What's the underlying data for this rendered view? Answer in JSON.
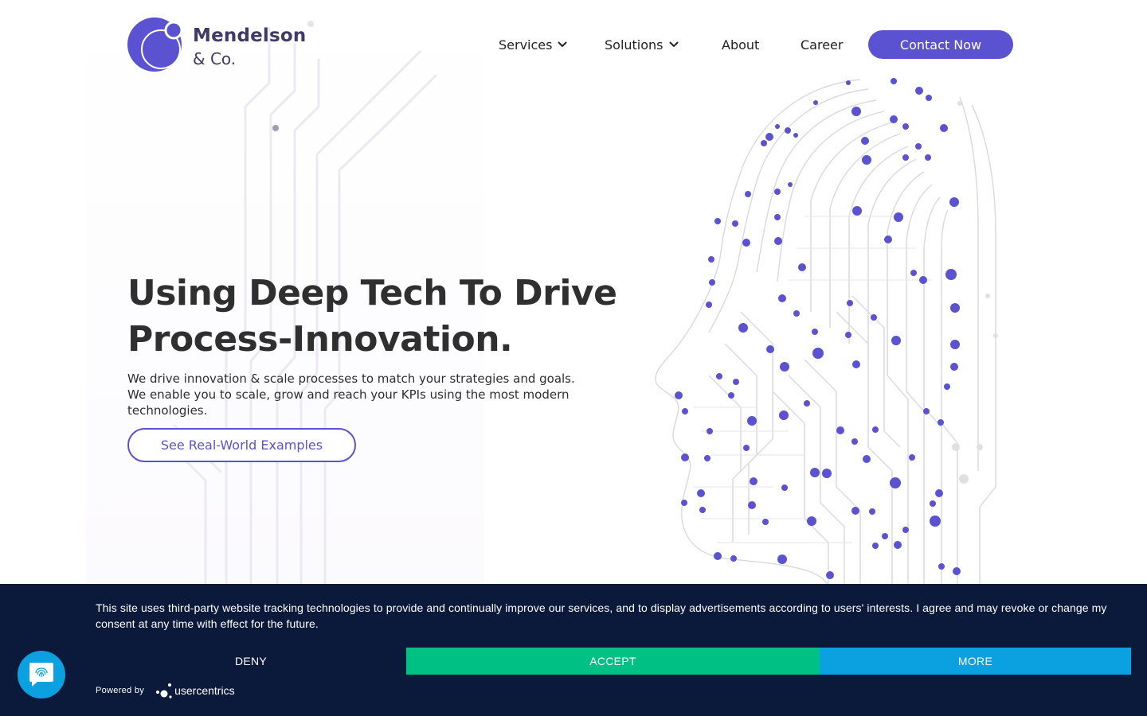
{
  "brand": {
    "name_line1": "Mendelson",
    "name_line2": "& Co.",
    "logo_color": "#5a52d0"
  },
  "nav": {
    "items": [
      {
        "label": "Services",
        "has_dropdown": true
      },
      {
        "label": "Solutions",
        "has_dropdown": true
      },
      {
        "label": "About",
        "has_dropdown": false
      },
      {
        "label": "Career",
        "has_dropdown": false
      }
    ],
    "cta_label": "Contact Now"
  },
  "hero": {
    "title_line1": "Using Deep Tech To Drive",
    "title_line2": "Process-Innovation.",
    "desc_line1": "We drive innovation & scale processes to match your strategies and goals.",
    "desc_line2": "We enable you to scale, grow and reach your KPIs using the most modern",
    "desc_line3": "technologies.",
    "cta_label": "See Real-World Examples"
  },
  "cookie_banner": {
    "text": "This site uses third-party website tracking technologies to provide and continually improve our services, and to display advertisements according to users' interests. I agree and may revoke or change my consent at any time with effect for the future.",
    "deny_label": "DENY",
    "accept_label": "ACCEPT",
    "more_label": "MORE",
    "powered_by_label": "Powered by",
    "provider_name": "usercentrics",
    "colors": {
      "background": "#0b1a3a",
      "accept": "#00c083",
      "more": "#0ba0e0"
    }
  },
  "chat_widget": {
    "icon": "fingerprint-chat-icon",
    "color": "#0ba0e0"
  },
  "theme": {
    "accent": "#5a52d0",
    "text": "#2f2f2f"
  }
}
